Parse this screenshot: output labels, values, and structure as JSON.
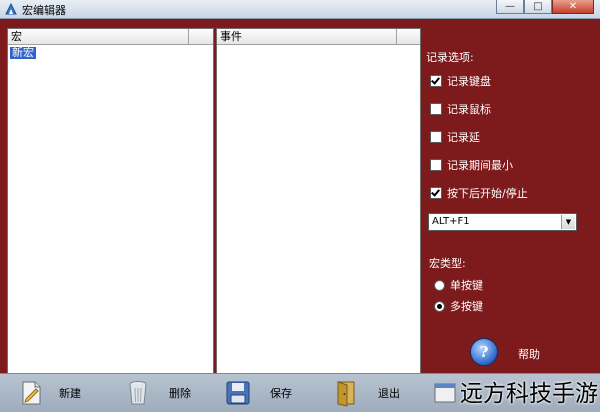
{
  "window": {
    "title": "宏编辑器",
    "buttons": {
      "minimize": "—",
      "maximize": "□",
      "close": "✕"
    }
  },
  "macro_panel": {
    "header": "宏",
    "items": [
      {
        "label": "新宏",
        "selected": true
      }
    ]
  },
  "events_panel": {
    "header": "事件",
    "items": []
  },
  "options": {
    "title": "记录选项:",
    "checkboxes": [
      {
        "label": "记录键盘",
        "checked": true
      },
      {
        "label": "记录鼠标",
        "checked": false
      },
      {
        "label": "记录延",
        "checked": false
      },
      {
        "label": "记录期间最小",
        "checked": false
      },
      {
        "label": "按下后开始/停止",
        "checked": true
      }
    ],
    "hotkey": {
      "value": "ALT+F1"
    },
    "type_label": "宏类型:",
    "radios": [
      {
        "label": "单按键",
        "selected": false
      },
      {
        "label": "多按键",
        "selected": true
      }
    ],
    "help_glyph": "?",
    "help_label": "帮助"
  },
  "toolbar": {
    "new_label": "新建",
    "delete_label": "删除",
    "save_label": "保存",
    "exit_label": "退出"
  },
  "watermark": "远方科技手游",
  "colors": {
    "background": "#7c1a1c",
    "selection": "#3064c8",
    "toolbar": "#aab6c4"
  },
  "icons": {
    "new": "new-document-icon",
    "delete": "trash-bin-icon",
    "save": "floppy-disk-icon",
    "exit": "exit-door-icon",
    "help": "help-icon"
  }
}
